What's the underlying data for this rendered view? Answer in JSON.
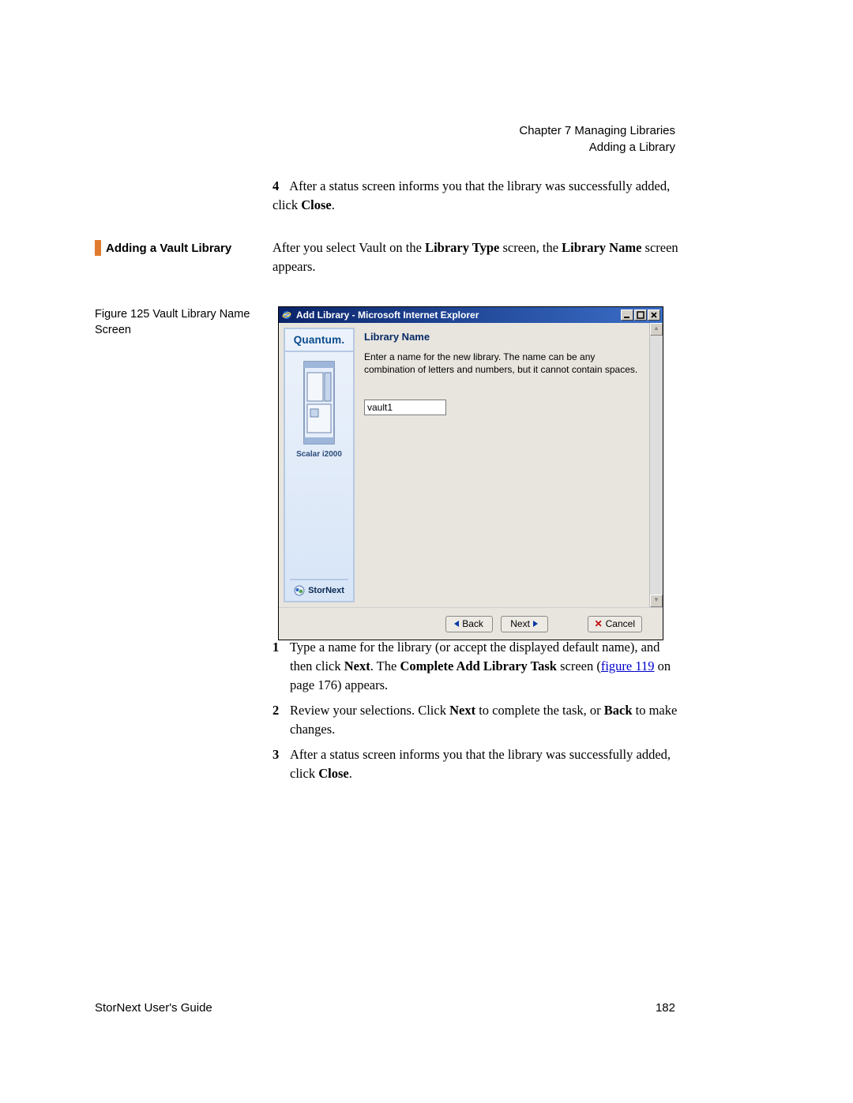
{
  "header": {
    "chapter": "Chapter 7  Managing Libraries",
    "section": "Adding a Library"
  },
  "step4": {
    "num": "4",
    "text_a": "After a status screen informs you that the library was successfully added, click ",
    "bold": "Close",
    "text_b": "."
  },
  "section_heading": "Adding a Vault Library",
  "intro": {
    "a": "After you select Vault on the ",
    "b1": "Library Type",
    "c": " screen, the ",
    "b2": "Library Name",
    "d": " screen appears."
  },
  "figure_caption": "Figure 125  Vault Library Name Screen",
  "window": {
    "title": "Add Library - Microsoft Internet Explorer",
    "sidebar": {
      "brand": "Quantum.",
      "device": "Scalar i2000",
      "product": "StorNext"
    },
    "content": {
      "title": "Library Name",
      "desc": "Enter a name for the new library. The name can be any combination of letters and numbers, but it cannot contain spaces.",
      "input_value": "vault1"
    },
    "buttons": {
      "back": "Back",
      "next": "Next",
      "cancel": "Cancel"
    }
  },
  "steps": {
    "s1": {
      "num": "1",
      "a": "Type a name for the library (or accept the displayed default name), and then click ",
      "b1": "Next",
      "c": ". The ",
      "b2": "Complete Add Library Task",
      "d": " screen (",
      "link": "figure 119",
      "e": " on page 176) appears."
    },
    "s2": {
      "num": "2",
      "a": "Review your selections. Click ",
      "b1": "Next",
      "c": " to complete the task, or ",
      "b2": "Back",
      "d": " to make changes."
    },
    "s3": {
      "num": "3",
      "a": "After a status screen informs you that the library was successfully added, click ",
      "b1": "Close",
      "c": "."
    }
  },
  "footer": {
    "left": "StorNext User's Guide",
    "right": "182"
  }
}
